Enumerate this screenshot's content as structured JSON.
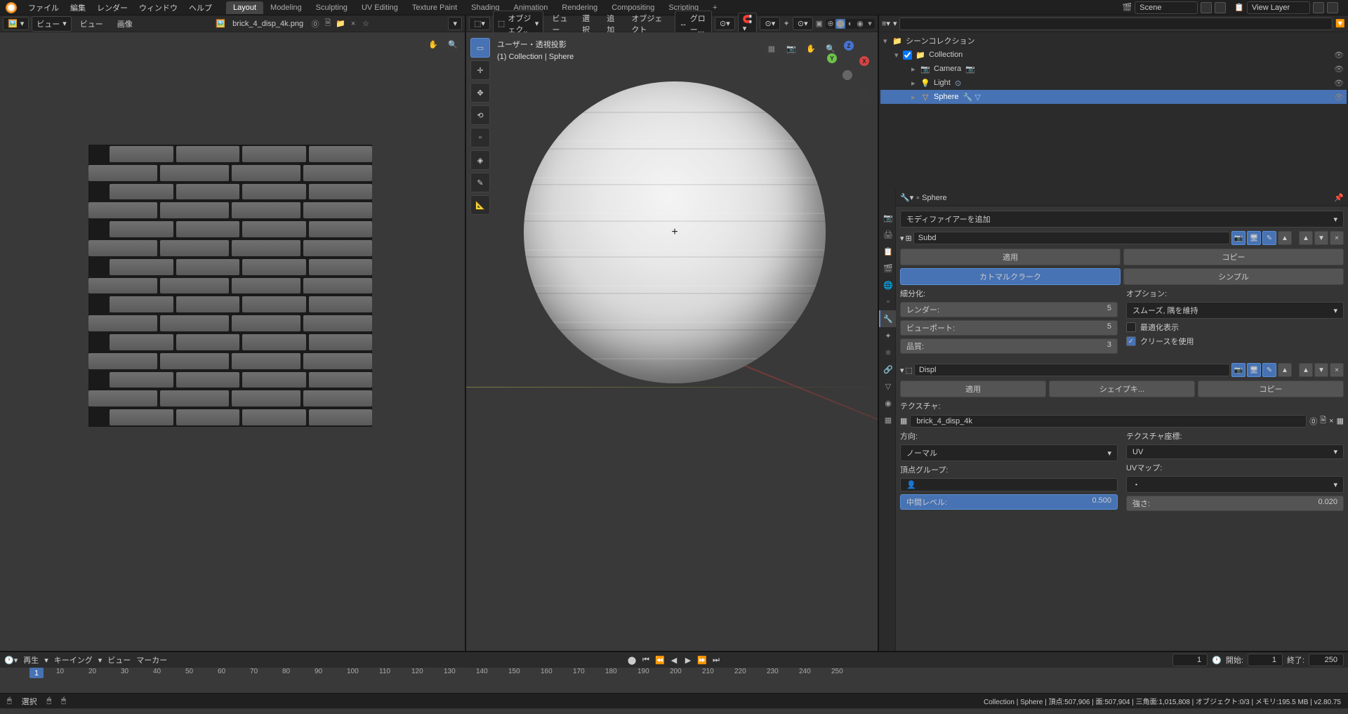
{
  "top_menu": {
    "file": "ファイル",
    "edit": "編集",
    "render": "レンダー",
    "window": "ウィンドウ",
    "help": "ヘルプ"
  },
  "workspaces": {
    "layout": "Layout",
    "modeling": "Modeling",
    "sculpting": "Sculpting",
    "uv": "UV Editing",
    "texpaint": "Texture Paint",
    "shading": "Shading",
    "animation": "Animation",
    "rendering": "Rendering",
    "compositing": "Compositing",
    "scripting": "Scripting"
  },
  "top_right": {
    "scene": "Scene",
    "viewlayer": "View Layer"
  },
  "image_editor": {
    "view_mode": "ビュー",
    "view": "ビュー",
    "image": "画像",
    "filename": "brick_4_disp_4k.png"
  },
  "viewport": {
    "mode": "オブジェク..",
    "view": "ビュー",
    "select": "選択",
    "add": "追加",
    "object": "オブジェクト",
    "transform_orient": "グロー...",
    "info_line1": "ユーザー・透視投影",
    "info_line2": "(1) Collection | Sphere"
  },
  "outliner": {
    "scene_collection": "シーンコレクション",
    "collection": "Collection",
    "camera": "Camera",
    "light": "Light",
    "sphere": "Sphere"
  },
  "properties": {
    "breadcrumb": "Sphere",
    "add_modifier": "モディファイアーを追加",
    "subd": {
      "name": "Subd",
      "apply": "適用",
      "copy": "コピー",
      "catmull": "カトマルクラーク",
      "simple": "シンプル",
      "subdivide_label": "細分化:",
      "options_label": "オプション:",
      "render_label": "レンダー:",
      "render_val": "5",
      "viewport_label": "ビューポート:",
      "viewport_val": "5",
      "quality_label": "品質:",
      "quality_val": "3",
      "smooth_label": "スムーズ, 隅を維持",
      "optimal_label": "最適化表示",
      "crease_label": "クリースを使用"
    },
    "displ": {
      "name": "Displ",
      "apply": "適用",
      "shapekey": "シェイプキ...",
      "copy": "コピー",
      "texture_label": "テクスチャ:",
      "texture_name": "brick_4_disp_4k",
      "direction_label": "方向:",
      "direction_val": "ノーマル",
      "texcoord_label": "テクスチャ座標:",
      "texcoord_val": "UV",
      "vgroup_label": "頂点グループ:",
      "uvmap_label": "UVマップ:",
      "midlevel_label": "中間レベル:",
      "midlevel_val": "0.500",
      "strength_label": "強さ:",
      "strength_val": "0.020"
    }
  },
  "timeline": {
    "playback": "再生",
    "keying": "キーイング",
    "view": "ビュー",
    "marker": "マーカー",
    "current_frame": "1",
    "start_label": "開始:",
    "start_val": "1",
    "end_label": "終了:",
    "end_val": "250",
    "ticks": [
      "10",
      "20",
      "30",
      "40",
      "50",
      "60",
      "70",
      "80",
      "90",
      "100",
      "110",
      "120",
      "130",
      "140",
      "150",
      "160",
      "170",
      "180",
      "190",
      "200",
      "210",
      "220",
      "230",
      "240",
      "250"
    ]
  },
  "status": {
    "select": "選択",
    "right": "Collection | Sphere | 頂点:507,906 | 面:507,904 | 三角面:1,015,808 | オブジェクト:0/3 | メモリ:195.5 MB | v2.80.75"
  }
}
